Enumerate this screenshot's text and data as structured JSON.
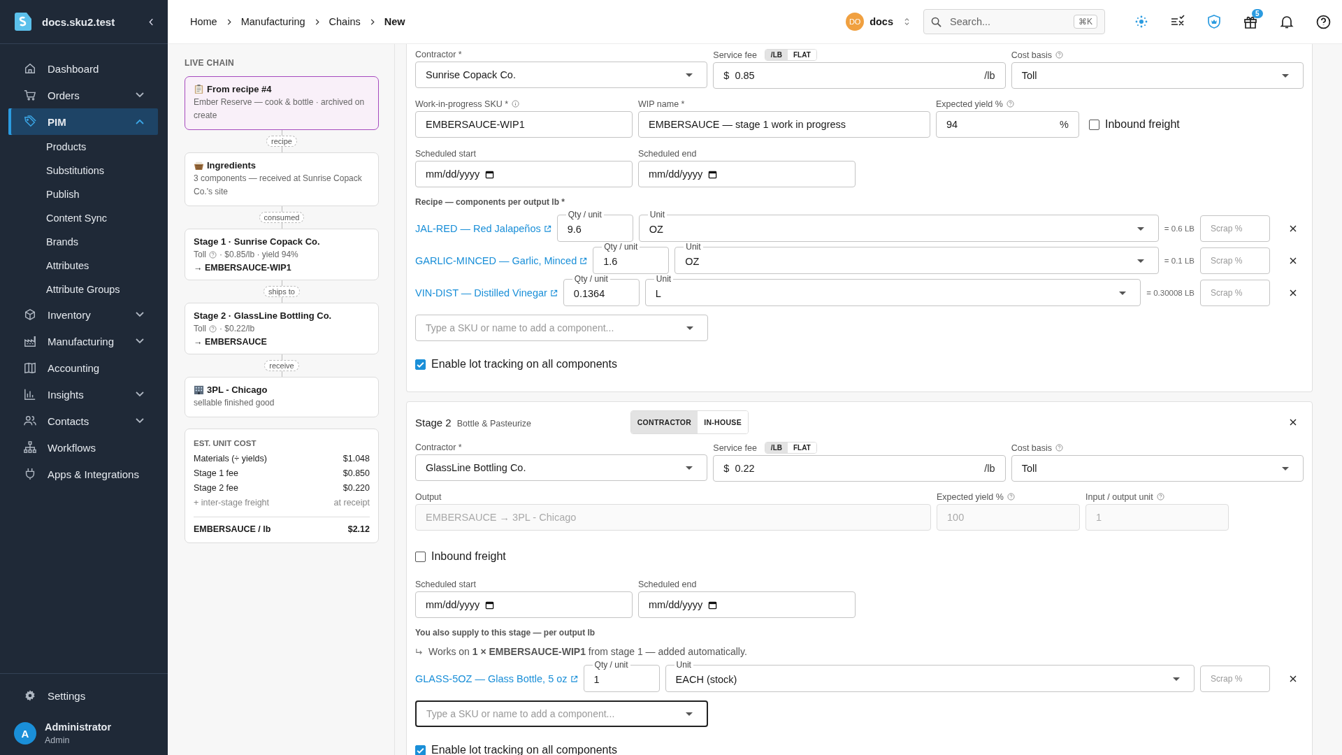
{
  "app": {
    "name": "docs.sku2.test"
  },
  "sidebar": {
    "items": [
      {
        "label": "Dashboard",
        "selected": false
      },
      {
        "label": "Orders",
        "expanded": false,
        "selected": false
      },
      {
        "label": "PIM",
        "expanded": true,
        "selected": true,
        "children": [
          {
            "label": "Products"
          },
          {
            "label": "Substitutions"
          },
          {
            "label": "Publish"
          },
          {
            "label": "Content Sync"
          },
          {
            "label": "Brands"
          },
          {
            "label": "Attributes"
          },
          {
            "label": "Attribute Groups"
          }
        ]
      },
      {
        "label": "Inventory",
        "expanded": false,
        "selected": false
      },
      {
        "label": "Manufacturing",
        "expanded": false,
        "selected": false
      },
      {
        "label": "Accounting",
        "selected": false
      },
      {
        "label": "Insights",
        "expanded": false,
        "selected": false
      },
      {
        "label": "Contacts",
        "expanded": false,
        "selected": false
      },
      {
        "label": "Workflows",
        "selected": false
      },
      {
        "label": "Apps & Integrations",
        "selected": false
      }
    ],
    "settings": "Settings",
    "user": {
      "initial": "A",
      "name": "Administrator",
      "role": "Admin"
    }
  },
  "breadcrumb": [
    "Home",
    "Manufacturing",
    "Chains",
    "New"
  ],
  "topbar": {
    "org_initials": "DO",
    "org": "docs",
    "search_placeholder": "Search...",
    "shortcut": "⌘K",
    "gift_count": "5"
  },
  "live_chain": {
    "title": "LIVE CHAIN",
    "nodes": [
      {
        "kind": "recipe",
        "selected": true,
        "title": "From recipe #4",
        "subtitle": "Ember Reserve — cook & bottle · archived on create",
        "link": "recipe"
      },
      {
        "kind": "ingredients",
        "selected": false,
        "title": "Ingredients",
        "subtitle": "3 components — received at Sunrise Copack Co.'s site",
        "link": "consumed"
      },
      {
        "kind": "stage",
        "selected": false,
        "title": "Stage 1 · Sunrise Copack Co.",
        "basis": "Toll",
        "detail": "· $0.85/lb · yield 94%",
        "output": "→ EMBERSAUCE-WIP1",
        "link": "ships to"
      },
      {
        "kind": "stage",
        "selected": false,
        "title": "Stage 2 · GlassLine Bottling Co.",
        "basis": "Toll",
        "detail": "· $0.22/lb",
        "output": "→ EMBERSAUCE",
        "link": "receive"
      },
      {
        "kind": "destination",
        "selected": false,
        "title": "3PL - Chicago",
        "subtitle": "sellable finished good"
      }
    ],
    "cost": {
      "title": "EST. UNIT COST",
      "rows": [
        {
          "label": "Materials (÷ yields)",
          "value": "$1.048",
          "muted": false
        },
        {
          "label": "Stage 1 fee",
          "value": "$0.850",
          "muted": false
        },
        {
          "label": "Stage 2 fee",
          "value": "$0.220",
          "muted": false
        },
        {
          "label": "+ inter-stage freight",
          "value": "at receipt",
          "muted": true
        }
      ],
      "total": {
        "label": "EMBERSAUCE / lb",
        "value": "$2.12"
      }
    }
  },
  "stage_1": {
    "contractor": {
      "label": "Contractor *",
      "value": "Sunrise Copack Co."
    },
    "fee": {
      "label": "Service fee",
      "modes": [
        {
          "label": "/LB",
          "selected": true
        },
        {
          "label": "FLAT",
          "selected": false
        }
      ],
      "prefix": "$",
      "value": "0.85",
      "suffix": "/lb"
    },
    "cost_basis": {
      "label": "Cost basis",
      "value": "Toll"
    },
    "wip_sku": {
      "label": "Work-in-progress SKU *",
      "value": "EMBERSAUCE-WIP1"
    },
    "wip_name": {
      "label": "WIP name *",
      "value": "EMBERSAUCE — stage 1 work in progress"
    },
    "yield": {
      "label": "Expected yield %",
      "value": "94",
      "suffix": "%"
    },
    "inbound_freight": {
      "label": "Inbound freight",
      "checked": false
    },
    "scheduled_start": {
      "label": "Scheduled start",
      "placeholder": "mm/dd/yyyy"
    },
    "scheduled_end": {
      "label": "Scheduled end",
      "placeholder": "mm/dd/yyyy"
    },
    "recipe_label": "Recipe — components per output lb *",
    "components": [
      {
        "sku": "JAL-RED — Red Jalapeños",
        "qty_label": "Qty / unit",
        "qty": "9.6",
        "unit_label": "Unit",
        "unit": "OZ",
        "converted": "= 0.6 LB",
        "scrap_placeholder": "Scrap %"
      },
      {
        "sku": "GARLIC-MINCED — Garlic, Minced",
        "qty_label": "Qty / unit",
        "qty": "1.6",
        "unit_label": "Unit",
        "unit": "OZ",
        "converted": "= 0.1 LB",
        "scrap_placeholder": "Scrap %"
      },
      {
        "sku": "VIN-DIST — Distilled Vinegar",
        "qty_label": "Qty / unit",
        "qty": "0.1364",
        "unit_label": "Unit",
        "unit": "L",
        "converted": "= 0.30008 LB",
        "scrap_placeholder": "Scrap %"
      }
    ],
    "add_component": {
      "placeholder": "Type a SKU or name to add a component...",
      "focused": false
    },
    "lot_tracking": {
      "label": "Enable lot tracking on all components",
      "checked": true
    }
  },
  "stage_2": {
    "title": "Stage 2",
    "subtitle": "Bottle & Pasteurize",
    "modes": [
      {
        "label": "CONTRACTOR",
        "selected": true
      },
      {
        "label": "IN-HOUSE",
        "selected": false
      }
    ],
    "contractor": {
      "label": "Contractor *",
      "value": "GlassLine Bottling Co."
    },
    "fee": {
      "label": "Service fee",
      "modes": [
        {
          "label": "/LB",
          "selected": true
        },
        {
          "label": "FLAT",
          "selected": false
        }
      ],
      "prefix": "$",
      "value": "0.22",
      "suffix": "/lb"
    },
    "cost_basis": {
      "label": "Cost basis",
      "value": "Toll"
    },
    "output": {
      "label": "Output",
      "value": "EMBERSAUCE → 3PL - Chicago",
      "disabled": true
    },
    "yield": {
      "label": "Expected yield %",
      "value": "100",
      "disabled": true
    },
    "io_unit": {
      "label": "Input / output unit",
      "value": "1",
      "disabled": true
    },
    "inbound_freight": {
      "label": "Inbound freight",
      "checked": false
    },
    "scheduled_start": {
      "label": "Scheduled start",
      "placeholder": "mm/dd/yyyy"
    },
    "scheduled_end": {
      "label": "Scheduled end",
      "placeholder": "mm/dd/yyyy"
    },
    "supply_label": "You also supply to this stage — per output lb",
    "auto_note": "Works on **1 × EMBERSAUCE-WIP1** from stage 1 — added automatically.",
    "components": [
      {
        "sku": "GLASS-5OZ — Glass Bottle, 5 oz",
        "qty_label": "Qty / unit",
        "qty": "1",
        "unit_label": "Unit",
        "unit": "EACH (stock)",
        "scrap_placeholder": "Scrap %"
      }
    ],
    "add_component": {
      "placeholder": "Type a SKU or name to add a component...",
      "focused": true
    },
    "lot_tracking": {
      "label": "Enable lot tracking on all components",
      "checked": true
    }
  }
}
